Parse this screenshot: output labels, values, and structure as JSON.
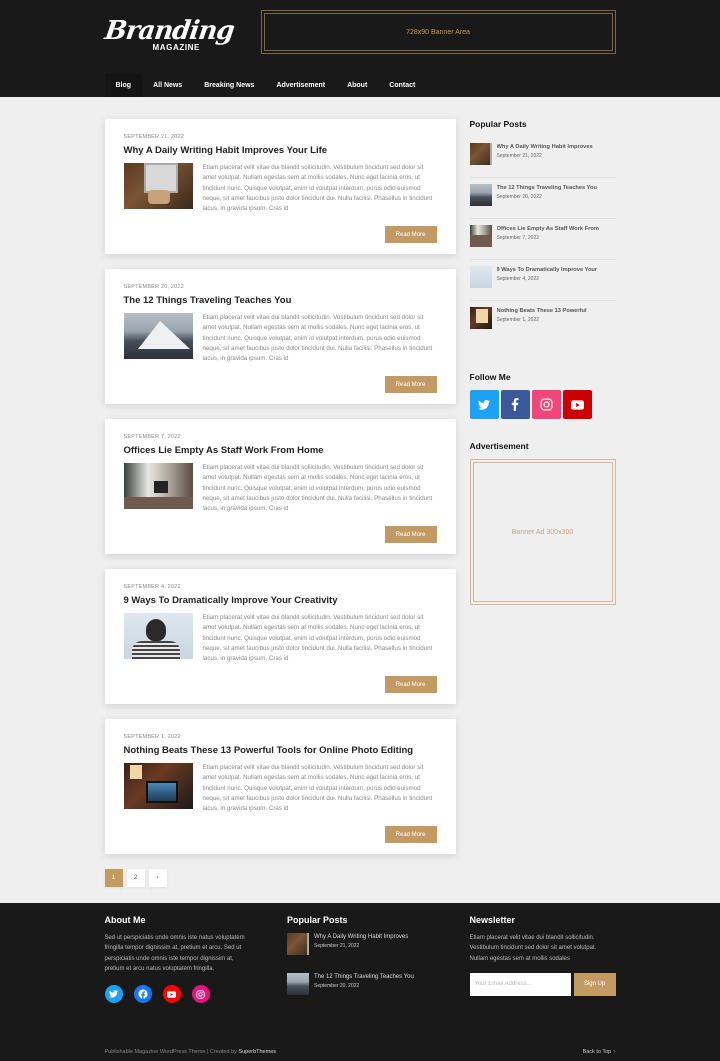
{
  "header": {
    "logo_script": "Branding",
    "logo_sub": "MAGAZINE",
    "banner_text": "728x90 Banner Area",
    "nav": [
      {
        "label": "Blog",
        "active": true
      },
      {
        "label": "All News",
        "active": false
      },
      {
        "label": "Breaking News",
        "active": false
      },
      {
        "label": "Advertisement",
        "active": false
      },
      {
        "label": "About",
        "active": false
      },
      {
        "label": "Contact",
        "active": false
      }
    ]
  },
  "posts": [
    {
      "date": "September 21, 2022",
      "title": "Why A Daily Writing Habit Improves Your Life",
      "image": "laptop-image",
      "excerpt": "Etiam placerat velit vitae dui blandit sollicitudin. Vestibulum tincidunt sed dolor sit amet volutpat. Nullam egestas sem at mollis sodales. Nunc eget lacinia eros, ut tincidunt nunc. Quisque volutpat, enim id volutpat interdum, purus odio euismod neque, sit amet faucibus justo dolor tincidunt dui. Nulla facilisi. Phasellus in tincidunt lacus, in gravida ipsum. Cras id",
      "read_more": "Read More"
    },
    {
      "date": "September 20, 2022",
      "title": "The 12 Things Traveling Teaches You",
      "image": "mountain-image",
      "excerpt": "Etiam placerat velit vitae dui blandit sollicitudin. Vestibulum tincidunt sed dolor sit amet volutpat. Nullam egestas sem at mollis sodales. Nunc eget lacinia eros, ut tincidunt nunc. Quisque volutpat, enim id volutpat interdum, purus odio euismod neque, sit amet faucibus justo dolor tincidunt dui. Nulla facilisi. Phasellus in tincidunt lacus, in gravida ipsum. Cras id",
      "read_more": "Read More"
    },
    {
      "date": "September 7, 2022",
      "title": "Offices Lie Empty As Staff Work From Home",
      "image": "office-image",
      "excerpt": "Etiam placerat velit vitae dui blandit sollicitudin. Vestibulum tincidunt sed dolor sit amet volutpat. Nullam egestas sem at mollis sodales. Nunc eget lacinia eros, ut tincidunt nunc. Quisque volutpat, enim id volutpat interdum, purus odio euismod neque, sit amet faucibus justo dolor tincidunt dui. Nulla facilisi. Phasellus in tincidunt lacus, in gravida ipsum. Cras id",
      "read_more": "Read More"
    },
    {
      "date": "September 4, 2022",
      "title": "9 Ways To Dramatically Improve Your Creativity",
      "image": "creativity-image",
      "excerpt": "Etiam placerat velit vitae dui blandit sollicitudin. Vestibulum tincidunt sed dolor sit amet volutpat. Nullam egestas sem at mollis sodales. Nunc eget lacinia eros, ut tincidunt nunc. Quisque volutpat, enim id volutpat interdum, purus odio euismod neque, sit amet faucibus justo dolor tincidunt dui. Nulla facilisi. Phasellus in tincidunt lacus, in gravida ipsum. Cras id",
      "read_more": "Read More"
    },
    {
      "date": "September 1, 2022",
      "title": "Nothing Beats These 13 Powerful Tools for Online Photo Editing",
      "image": "photo-editing-image",
      "excerpt": "Etiam placerat velit vitae dui blandit sollicitudin. Vestibulum tincidunt sed dolor sit amet volutpat. Nullam egestas sem at mollis sodales. Nunc eget lacinia eros, ut tincidunt nunc. Quisque volutpat, enim id volutpat interdum, purus odio euismod neque, sit amet faucibus justo dolor tincidunt dui. Nulla facilisi. Phasellus in tincidunt lacus, in gravida ipsum. Cras id",
      "read_more": "Read More"
    }
  ],
  "pagination": {
    "pages": [
      "1",
      "2"
    ],
    "current": "1",
    "next": "›"
  },
  "sidebar": {
    "popular_title": "Popular Posts",
    "popular": [
      {
        "title": "Why A Daily Writing Habit Improves",
        "date": "September 21, 2022"
      },
      {
        "title": "The 12 Things Traveling Teaches You",
        "date": "September 20, 2022"
      },
      {
        "title": "Offices Lie Empty As Staff Work From",
        "date": "September 7, 2022"
      },
      {
        "title": "9 Ways To Dramatically Improve Your",
        "date": "September 4, 2022"
      },
      {
        "title": "Nothing Beats These 13 Powerful",
        "date": "September 1, 2022"
      }
    ],
    "follow_title": "Follow Me",
    "social": [
      "twitter",
      "facebook",
      "instagram",
      "youtube"
    ],
    "ad_title": "Advertisement",
    "ad_text": "Banner Ad 300x300"
  },
  "footer": {
    "about_title": "About Me",
    "about_text": "Sed ut perspiciatis unde omnis iste natus voluptatem fringilla tempor dignissim at, pretium et arcu. Sed ut perspiciatis unde omnis iste tempor dignissim at, pretium et arcu natus voluptatem fringilla.",
    "social": [
      "twitter",
      "facebook",
      "youtube",
      "instagram"
    ],
    "popular_title": "Popular Posts",
    "popular": [
      {
        "title": "Why A Daily Writing Habit Improves",
        "date": "September 21, 2022"
      },
      {
        "title": "The 12 Things Traveling Teaches You",
        "date": "September 20, 2022"
      }
    ],
    "newsletter_title": "Newsletter",
    "newsletter_text": "Etiam placerat velit vitae dui blandit sollicitudin. Vestibulum tincidunt sed dolor sit amet volutpat. Nullam egestas sem at mollis sodales",
    "email_placeholder": "Your Email Address...",
    "signup_label": "Sign Up",
    "credit_prefix": "Publishable Magazine WordPress Theme | Created by ",
    "credit_link": "SuperbThemes",
    "back_to_top": "Back to Top ↑"
  },
  "colors": {
    "accent": "#c49a63",
    "dark": "#1a1919",
    "background": "#efefef"
  }
}
